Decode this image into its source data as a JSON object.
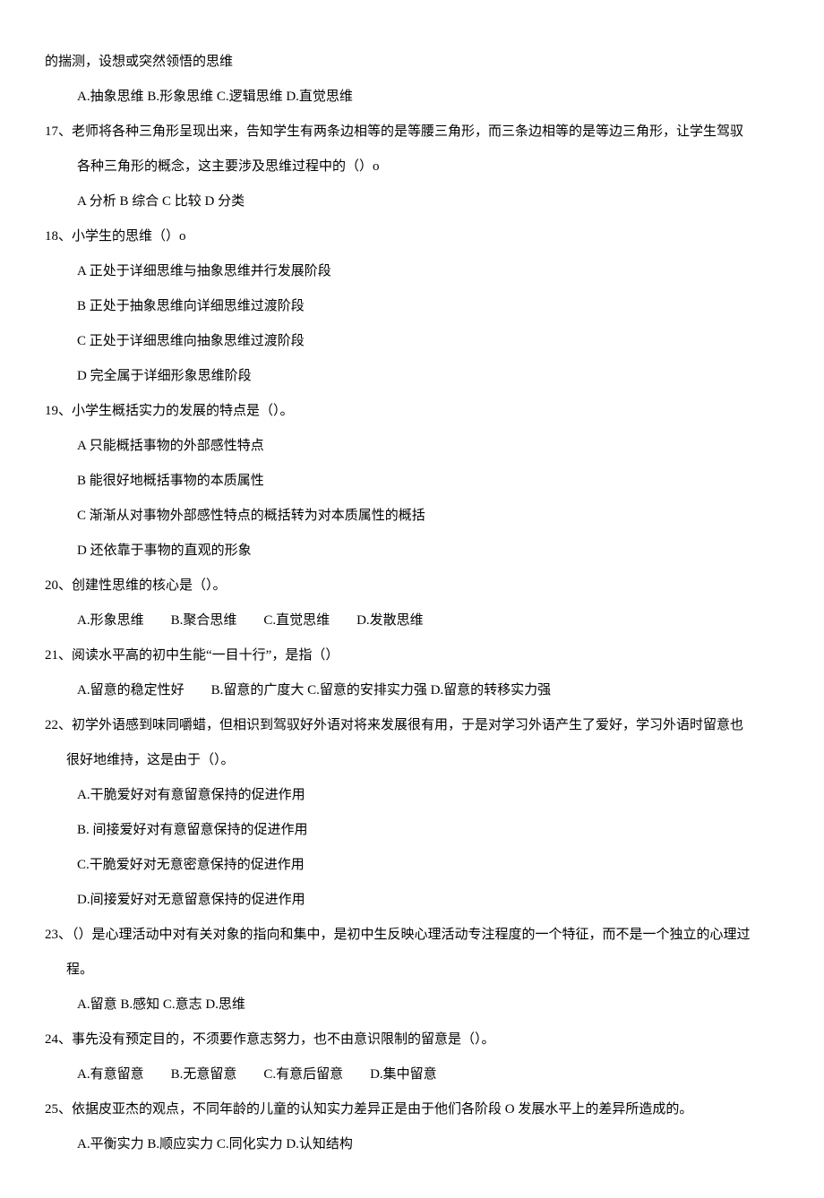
{
  "intro_line": "的揣测，设想或突然领悟的思维",
  "intro_options": "A.抽象思维 B.形象思维 C.逻辑思维 D.直觉思维",
  "q17": {
    "text": "17、老师将各种三角形呈现出来，告知学生有两条边相等的是等腰三角形，而三条边相等的是等边三角形，让学生驾驭",
    "text2": "各种三角形的概念，这主要涉及思维过程中的（）o",
    "options": "A 分析 B 综合 C 比较 D 分类"
  },
  "q18": {
    "text": "18、小学生的思维（）o",
    "a": "A 正处于详细思维与抽象思维并行发展阶段",
    "b": "B 正处于抽象思维向详细思维过渡阶段",
    "c": "C 正处于详细思维向抽象思维过渡阶段",
    "d": "D 完全属于详细形象思维阶段"
  },
  "q19": {
    "text": "19、小学生概括实力的发展的特点是（）。",
    "a": "A 只能概括事物的外部感性特点",
    "b": "B 能很好地概括事物的本质属性",
    "c": "C 渐渐从对事物外部感性特点的概括转为对本质属性的概括",
    "d": "D 还依靠于事物的直观的形象"
  },
  "q20": {
    "text": "20、创建性思维的核心是（）。",
    "options": "A.形象思维  B.聚合思维  C.直觉思维  D.发散思维"
  },
  "q21": {
    "text": "21、阅读水平高的初中生能“一目十行”，是指（）",
    "options": "A.留意的稳定性好  B.留意的广度大 C.留意的安排实力强 D.留意的转移实力强"
  },
  "q22": {
    "text": "22、初学外语感到味同嚼蜡，但相识到驾驭好外语对将来发展很有用，于是对学习外语产生了爱好，学习外语时留意也",
    "text2": "很好地维持，这是由于（）。",
    "a": "A.干脆爱好对有意留意保持的促进作用",
    "b": "B. 间接爱好对有意留意保持的促进作用",
    "c": "C.干脆爱好对无意密意保持的促进作用",
    "d": "D.间接爱好对无意留意保持的促进作用"
  },
  "q23": {
    "text": "23、（）是心理活动中对有关对象的指向和集中，是初中生反映心理活动专注程度的一个特征，而不是一个独立的心理过",
    "text2": "程。",
    "options": "A.留意 B.感知 C.意志 D.思维"
  },
  "q24": {
    "text": "24、事先没有预定目的，不须要作意志努力，也不由意识限制的留意是（）。",
    "options": "A.有意留意  B.无意留意  C.有意后留意  D.集中留意"
  },
  "q25": {
    "text": "25、依据皮亚杰的观点，不同年龄的儿童的认知实力差异正是由于他们各阶段 O 发展水平上的差异所造成的。",
    "options": "A.平衡实力 B.顺应实力 C.同化实力 D.认知结构"
  }
}
